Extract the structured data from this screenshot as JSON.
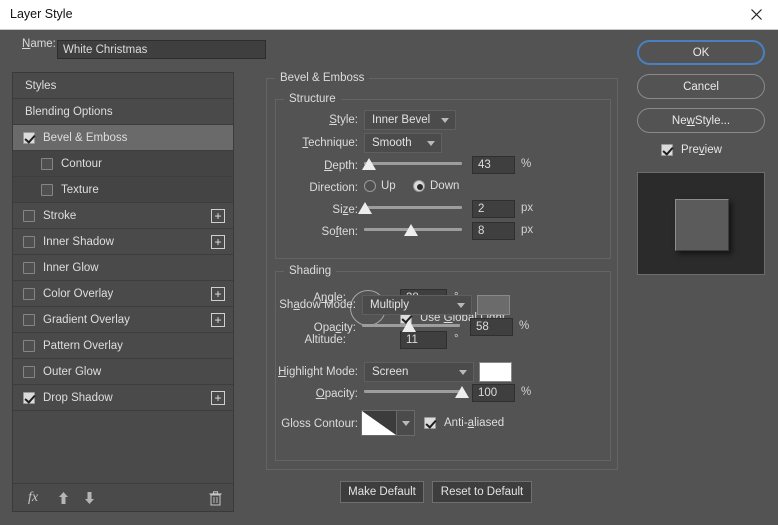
{
  "window": {
    "title": "Layer Style",
    "close_icon": "close-icon"
  },
  "name_field": {
    "label": "Name:",
    "label_accel": "N",
    "value": "White Christmas"
  },
  "sidebar": {
    "items": [
      {
        "label": "Styles",
        "type": "plain",
        "checkbox": null,
        "plus": false,
        "selected": false
      },
      {
        "label": "Blending Options",
        "type": "plain",
        "checkbox": null,
        "plus": false,
        "selected": false
      },
      {
        "label": "Bevel & Emboss",
        "type": "main",
        "checkbox": "checked",
        "plus": false,
        "selected": true
      },
      {
        "label": "Contour",
        "type": "sub",
        "checkbox": "unchecked",
        "plus": false,
        "selected": false
      },
      {
        "label": "Texture",
        "type": "sub",
        "checkbox": "unchecked",
        "plus": false,
        "selected": false
      },
      {
        "label": "Stroke",
        "type": "main",
        "checkbox": "unchecked",
        "plus": true,
        "selected": false
      },
      {
        "label": "Inner Shadow",
        "type": "main",
        "checkbox": "unchecked",
        "plus": true,
        "selected": false
      },
      {
        "label": "Inner Glow",
        "type": "main",
        "checkbox": "unchecked",
        "plus": false,
        "selected": false
      },
      {
        "label": "Color Overlay",
        "type": "main",
        "checkbox": "unchecked",
        "plus": true,
        "selected": false
      },
      {
        "label": "Gradient Overlay",
        "type": "main",
        "checkbox": "unchecked",
        "plus": true,
        "selected": false
      },
      {
        "label": "Pattern Overlay",
        "type": "main",
        "checkbox": "unchecked",
        "plus": false,
        "selected": false
      },
      {
        "label": "Outer Glow",
        "type": "main",
        "checkbox": "unchecked",
        "plus": false,
        "selected": false
      },
      {
        "label": "Drop Shadow",
        "type": "main",
        "checkbox": "checked",
        "plus": true,
        "selected": false
      }
    ],
    "footer_icons": [
      "fx-icon",
      "move-up-icon",
      "move-down-icon",
      "trash-icon"
    ],
    "fx_label": "fx"
  },
  "panel": {
    "title": "Bevel & Emboss",
    "structure": {
      "legend": "Structure",
      "style": {
        "label": "Style:",
        "accel": "S",
        "value": "Inner Bevel"
      },
      "technique": {
        "label": "Technique:",
        "accel": "T",
        "value": "Smooth"
      },
      "depth": {
        "label": "Depth:",
        "accel": "D",
        "value": "43",
        "unit": "%",
        "slider_pct": 5
      },
      "direction": {
        "label": "Direction:",
        "options": [
          "Up",
          "Down"
        ],
        "selected": "Down"
      },
      "size": {
        "label": "Size:",
        "accel": "z",
        "value": "2",
        "unit": "px",
        "slider_pct": 1
      },
      "soften": {
        "label": "Soften:",
        "accel": "f",
        "value": "8",
        "unit": "px",
        "slider_pct": 48
      }
    },
    "shading": {
      "legend": "Shading",
      "angle": {
        "label": "Angle:",
        "accel": "n",
        "value": "38",
        "unit": "°",
        "degrees": 38
      },
      "use_global_light": {
        "label": "Use Global Light",
        "accel": "G",
        "checked": true
      },
      "altitude": {
        "label": "Altitude:",
        "value": "11",
        "unit": "°"
      },
      "gloss_contour": {
        "label": "Gloss Contour:",
        "contour": "linear-contour"
      },
      "anti_aliased": {
        "label": "Anti-aliased",
        "accel": "a",
        "checked": true
      },
      "highlight_mode": {
        "label": "Highlight Mode:",
        "accel": "H",
        "value": "Screen",
        "color": "#ffffff"
      },
      "highlight_opacity": {
        "label": "Opacity:",
        "accel": "O",
        "value": "100",
        "unit": "%",
        "slider_pct": 100
      },
      "shadow_mode": {
        "label": "Shadow Mode:",
        "accel": "a",
        "value": "Multiply",
        "color": "#6b6b6b"
      },
      "shadow_opacity": {
        "label": "Opacity:",
        "accel": "c",
        "value": "58",
        "unit": "%",
        "slider_pct": 48
      }
    }
  },
  "right": {
    "ok": "OK",
    "cancel": "Cancel",
    "new_style": "New Style...",
    "new_style_accel": "w",
    "preview": {
      "label": "Preview",
      "accel": "v",
      "checked": true
    }
  },
  "bottom": {
    "make_default": "Make Default",
    "reset_to_default": "Reset to Default"
  }
}
